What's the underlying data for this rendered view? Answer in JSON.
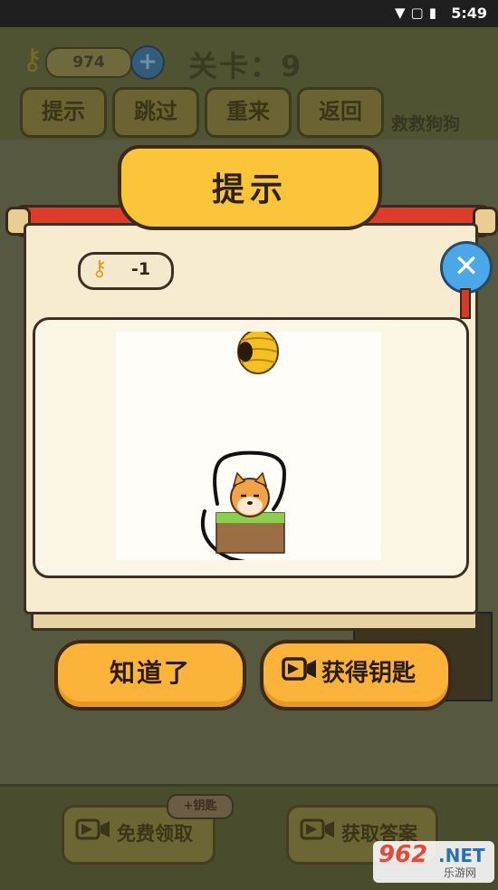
{
  "status_bar": {
    "time": "5:49",
    "icons": [
      "wifi-icon",
      "no-sim-icon",
      "battery-charging-icon"
    ]
  },
  "header": {
    "key_count": "974",
    "level_label": "关卡：9",
    "buttons": [
      "提示",
      "跳过",
      "重来",
      "返回"
    ],
    "level_name": "救救狗狗"
  },
  "dialog": {
    "title": "提示",
    "key_cost": "-1",
    "confirm_label": "知道了",
    "get_keys_label": "获得钥匙"
  },
  "bottom": {
    "free_claim_label": "免费领取",
    "free_claim_badge": "+钥匙",
    "get_answer_label": "获取答案"
  },
  "watermark": {
    "brand": "962",
    "suffix": ".NET",
    "sub": "乐游网"
  },
  "colors": {
    "accent_yellow": "#fbb33a",
    "scroll_red": "#e03a2a",
    "close_blue": "#4aa7e8"
  }
}
